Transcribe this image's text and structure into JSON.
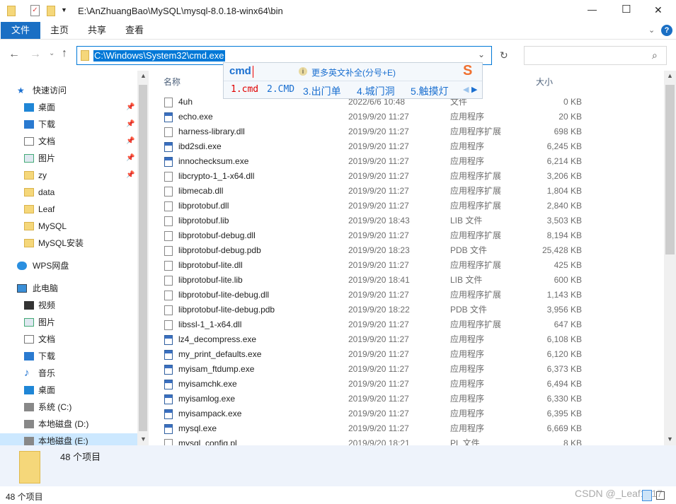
{
  "window": {
    "title": "E:\\AnZhuangBao\\MySQL\\mysql-8.0.18-winx64\\bin",
    "minimize": "—",
    "maximize": "☐",
    "close": "✕"
  },
  "ribbon": {
    "tabs": [
      "文件",
      "主页",
      "共享",
      "查看"
    ],
    "help": "?"
  },
  "address": {
    "value": "C:\\Windows\\System32\\cmd.exe",
    "search_placeholder": ""
  },
  "ime": {
    "input": "cmd",
    "hint": "更多英文补全(分号+E)",
    "candidates": [
      "1.cmd",
      "2.CMD",
      "3.出门单",
      "4.城门洞",
      "5.触摸灯"
    ]
  },
  "columns": {
    "name": "名称",
    "size": "大小"
  },
  "sidebar": [
    {
      "label": "快速访问",
      "icon": "star-icon",
      "level": 0
    },
    {
      "label": "桌面",
      "icon": "desktop-icon",
      "pin": true
    },
    {
      "label": "下载",
      "icon": "download-icon",
      "pin": true
    },
    {
      "label": "文档",
      "icon": "document-icon",
      "pin": true
    },
    {
      "label": "图片",
      "icon": "picture-icon",
      "pin": true
    },
    {
      "label": "zy",
      "icon": "folder-icon",
      "pin": true
    },
    {
      "label": "data",
      "icon": "folder-icon"
    },
    {
      "label": "Leaf",
      "icon": "folder-icon"
    },
    {
      "label": "MySQL",
      "icon": "folder-icon"
    },
    {
      "label": "MySQL安装",
      "icon": "folder-icon"
    },
    {
      "label": "WPS网盘",
      "icon": "cloud-icon",
      "level": 0
    },
    {
      "label": "此电脑",
      "icon": "computer-icon",
      "level": 0
    },
    {
      "label": "视频",
      "icon": "video-icon"
    },
    {
      "label": "图片",
      "icon": "picture-icon"
    },
    {
      "label": "文档",
      "icon": "document-icon"
    },
    {
      "label": "下载",
      "icon": "download-icon"
    },
    {
      "label": "音乐",
      "icon": "music-icon"
    },
    {
      "label": "桌面",
      "icon": "desktop-icon"
    },
    {
      "label": "系统 (C:)",
      "icon": "drive-icon"
    },
    {
      "label": "本地磁盘 (D:)",
      "icon": "drive-icon"
    },
    {
      "label": "本地磁盘 (E:)",
      "icon": "drive-icon",
      "selected": true
    }
  ],
  "files": [
    [
      "4uh",
      "2022/6/6 10:48",
      "文件",
      "0 KB",
      "file"
    ],
    [
      "echo.exe",
      "2019/9/20 11:27",
      "应用程序",
      "20 KB",
      "exe"
    ],
    [
      "harness-library.dll",
      "2019/9/20 11:27",
      "应用程序扩展",
      "698 KB",
      "dll"
    ],
    [
      "ibd2sdi.exe",
      "2019/9/20 11:27",
      "应用程序",
      "6,245 KB",
      "exe"
    ],
    [
      "innochecksum.exe",
      "2019/9/20 11:27",
      "应用程序",
      "6,214 KB",
      "exe"
    ],
    [
      "libcrypto-1_1-x64.dll",
      "2019/9/20 11:27",
      "应用程序扩展",
      "3,206 KB",
      "dll"
    ],
    [
      "libmecab.dll",
      "2019/9/20 11:27",
      "应用程序扩展",
      "1,804 KB",
      "dll"
    ],
    [
      "libprotobuf.dll",
      "2019/9/20 11:27",
      "应用程序扩展",
      "2,840 KB",
      "dll"
    ],
    [
      "libprotobuf.lib",
      "2019/9/20 18:43",
      "LIB 文件",
      "3,503 KB",
      "file"
    ],
    [
      "libprotobuf-debug.dll",
      "2019/9/20 11:27",
      "应用程序扩展",
      "8,194 KB",
      "dll"
    ],
    [
      "libprotobuf-debug.pdb",
      "2019/9/20 18:23",
      "PDB 文件",
      "25,428 KB",
      "file"
    ],
    [
      "libprotobuf-lite.dll",
      "2019/9/20 11:27",
      "应用程序扩展",
      "425 KB",
      "dll"
    ],
    [
      "libprotobuf-lite.lib",
      "2019/9/20 18:41",
      "LIB 文件",
      "600 KB",
      "file"
    ],
    [
      "libprotobuf-lite-debug.dll",
      "2019/9/20 11:27",
      "应用程序扩展",
      "1,143 KB",
      "dll"
    ],
    [
      "libprotobuf-lite-debug.pdb",
      "2019/9/20 18:22",
      "PDB 文件",
      "3,956 KB",
      "file"
    ],
    [
      "libssl-1_1-x64.dll",
      "2019/9/20 11:27",
      "应用程序扩展",
      "647 KB",
      "dll"
    ],
    [
      "lz4_decompress.exe",
      "2019/9/20 11:27",
      "应用程序",
      "6,108 KB",
      "exe"
    ],
    [
      "my_print_defaults.exe",
      "2019/9/20 11:27",
      "应用程序",
      "6,120 KB",
      "exe"
    ],
    [
      "myisam_ftdump.exe",
      "2019/9/20 11:27",
      "应用程序",
      "6,373 KB",
      "exe"
    ],
    [
      "myisamchk.exe",
      "2019/9/20 11:27",
      "应用程序",
      "6,494 KB",
      "exe"
    ],
    [
      "myisamlog.exe",
      "2019/9/20 11:27",
      "应用程序",
      "6,330 KB",
      "exe"
    ],
    [
      "myisampack.exe",
      "2019/9/20 11:27",
      "应用程序",
      "6,395 KB",
      "exe"
    ],
    [
      "mysql.exe",
      "2019/9/20 11:27",
      "应用程序",
      "6,669 KB",
      "exe"
    ],
    [
      "mysql_config.pl",
      "2019/9/20 18:21",
      "PL 文件",
      "8 KB",
      "file"
    ]
  ],
  "details": {
    "count": "48 个项目"
  },
  "status": {
    "count": "48 个项目",
    "watermark": "CSDN @_Leaf1217"
  },
  "colors": {
    "accent": "#0078d7",
    "ime_text": "#1a6fd0",
    "ime_selected": "#e00000"
  }
}
